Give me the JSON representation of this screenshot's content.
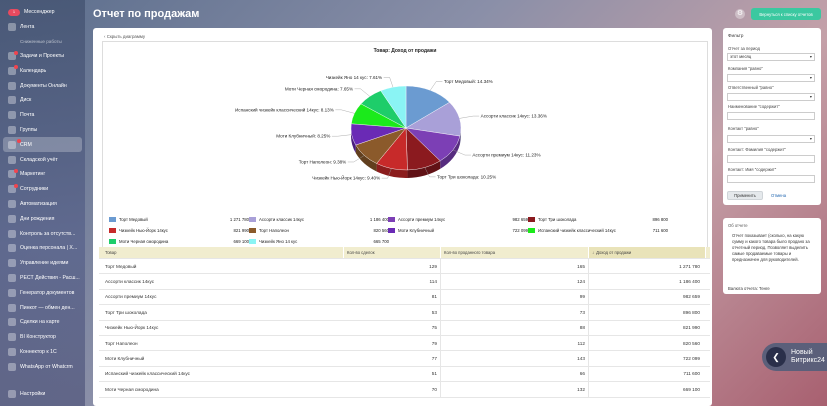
{
  "sidebar": {
    "top_badge": "1",
    "items_top": [
      {
        "label": "Мессенджер",
        "badge": true
      },
      {
        "label": "Лента",
        "badge": false
      }
    ],
    "section": "Сниженные работы",
    "items": [
      {
        "label": "Задачи и Проекты",
        "badge": true
      },
      {
        "label": "Календарь",
        "badge": true
      },
      {
        "label": "Документы Онлайн",
        "badge": false
      },
      {
        "label": "Диск",
        "badge": false
      },
      {
        "label": "Почта",
        "badge": false
      },
      {
        "label": "Группы",
        "badge": false
      },
      {
        "label": "CRM",
        "badge": true
      },
      {
        "label": "Складской учёт",
        "badge": false
      },
      {
        "label": "Маркетинг",
        "badge": true
      },
      {
        "label": "Сотрудники",
        "badge": true
      },
      {
        "label": "Автоматизация",
        "badge": false
      },
      {
        "label": "Дни рождения",
        "badge": false
      },
      {
        "label": "Контроль за отсутств...",
        "badge": false
      },
      {
        "label": "Оценка персонала | Х...",
        "badge": false
      },
      {
        "label": "Управление идеями",
        "badge": false
      },
      {
        "label": "РЕСТ Действия - Расш...",
        "badge": false
      },
      {
        "label": "Генератор документов",
        "badge": false
      },
      {
        "label": "Пинкот — обмен ден...",
        "badge": false
      },
      {
        "label": "Сделки на карте",
        "badge": false
      },
      {
        "label": "BI Конструктор",
        "badge": false
      },
      {
        "label": "Коннектор к 1С",
        "badge": false
      },
      {
        "label": "WhatsApp от Whatcrm",
        "badge": false
      },
      {
        "label": "Настройки",
        "badge": false
      }
    ]
  },
  "header": {
    "title": "Отчет по продажам",
    "back_button": "Вернуться к списку отчетов"
  },
  "main": {
    "hide_chart_link": "Скрыть диаграмму"
  },
  "chart_data": {
    "type": "pie",
    "title": "Товар: Доход от продажи",
    "categories": [
      "Торт Медовый",
      "Ассорти классик 14кус",
      "Ассорти премиум 14кус",
      "Торт Три шоколада",
      "Чизкейк Нью-Йорк 14кус",
      "Торт Наполеон",
      "Моти Клубничный",
      "Испанский чизкейк классический 14кус",
      "Моти Черная смородина",
      "Чизкейк Яно 14 кус"
    ],
    "values": [
      1271780,
      1186400,
      982659,
      896800,
      821990,
      820560,
      722099,
      711600,
      669100,
      665700
    ],
    "percent_labels": [
      "14.34%",
      "13.36%",
      "11.23%",
      "10.25%",
      "9.40%",
      "9.38%",
      "8.25%",
      "8.13%",
      "7.65%",
      "7.61%"
    ],
    "legend_values": [
      "1 271 780",
      "1 186 400",
      "982 659",
      "896 800",
      "821 990",
      "820 560",
      "722 099",
      "711 600",
      "669 100",
      "665 700"
    ],
    "colors": [
      "#6b9bd1",
      "#a9a0d8",
      "#7c3fb5",
      "#8b1a1f",
      "#c72a2a",
      "#8b5a2b",
      "#6a2ab5",
      "#1bea1b",
      "#1ecd6a",
      "#8af4f4"
    ]
  },
  "table": {
    "headers": [
      "Товар",
      "Кол-во сделок",
      "Кол-во проданного товара",
      "Доход от продажи"
    ],
    "sort_indicator": "↓",
    "rows": [
      [
        "Торт Медовый",
        "129",
        "165",
        "1 271 780"
      ],
      [
        "Ассорти классик 14кус",
        "114",
        "124",
        "1 186 400"
      ],
      [
        "Ассорти премиум 14кус",
        "81",
        "99",
        "982 659"
      ],
      [
        "Торт Три шоколада",
        "53",
        "73",
        "896 800"
      ],
      [
        "Чизкейк Нью-Йорк 14кус",
        "75",
        "88",
        "821 990"
      ],
      [
        "Торт Наполеон",
        "79",
        "112",
        "820 560"
      ],
      [
        "Моти Клубничный",
        "77",
        "143",
        "722 099"
      ],
      [
        "Испанский чизкейк классический 14кус",
        "51",
        "66",
        "711 600"
      ],
      [
        "Моти Черная смородина",
        "70",
        "132",
        "669 100"
      ]
    ]
  },
  "filter": {
    "title": "Фильтр",
    "period_label": "Отчет за период",
    "period_value": "этот месяц",
    "company_label": "Компания \"равно\"",
    "responsible_label": "Ответственный \"равно\"",
    "name_label": "Наименование \"содержит\"",
    "contact_label": "Контакт \"равно\"",
    "contact_surname_label": "Контакт: Фамилия \"содержит\"",
    "contact_name_label": "Контакт: Имя \"содержит\"",
    "apply_button": "Применить",
    "cancel_link": "Отмена"
  },
  "about": {
    "head": "Об отчете",
    "text": "Отчет показывает (сколько, на какую сумму и какого товара было продано за отчетный период. Позволяет выделить самые продаваемые товары и предназначен для руководителей.",
    "base": "Валюта отчета: Тенге"
  },
  "promo": {
    "label": "Новый Битрикс24"
  }
}
